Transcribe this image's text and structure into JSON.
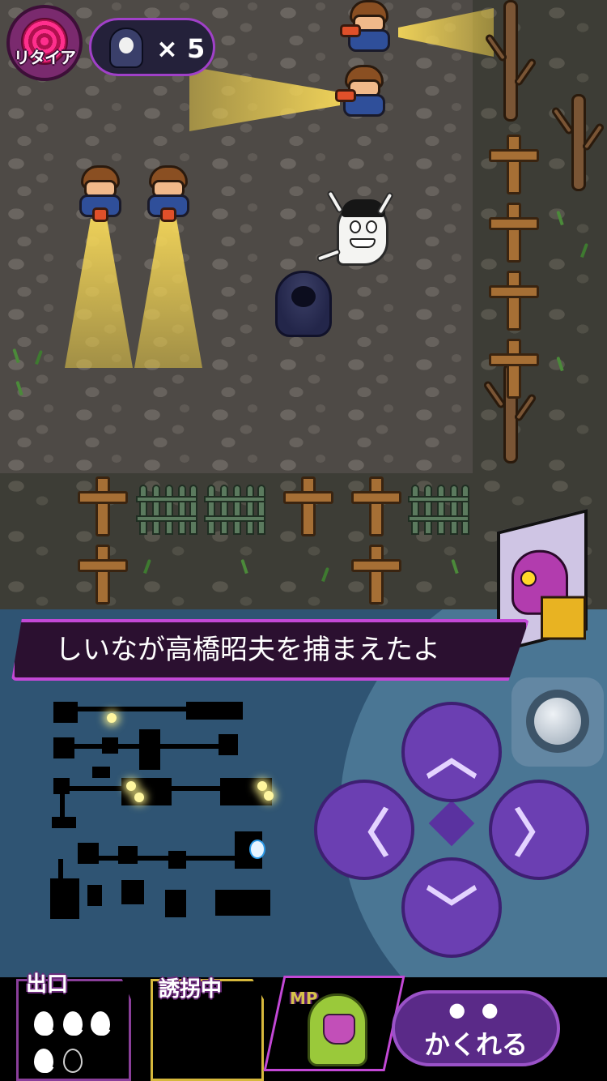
{
  "hud": {
    "retire_label": "リタイア",
    "ghost_count_text": "× 5"
  },
  "dialog": {
    "message": "しいなが高橋昭夫を捕まえたよ"
  },
  "bottom": {
    "exit_label": "出口",
    "exit_souls_filled": 4,
    "exit_souls_total": 5,
    "kidnap_label": "誘拐中",
    "mp_label": "MP",
    "hide_eyes": "● ●",
    "hide_label": "かくれる"
  },
  "colors": {
    "accent_purple": "#c348d6",
    "dpad_purple": "#6b3fb2",
    "panel_blue": "#2f5473",
    "beam_yellow": "#f5d75a"
  },
  "icons": {
    "retire": "pink-spiral-icon",
    "ghost_count": "reaper-ghost-icon",
    "up": "arrow-up-icon",
    "down": "arrow-down-icon",
    "left": "arrow-left-icon",
    "right": "arrow-right-icon"
  },
  "dpad": {
    "up": "︿",
    "down": "﹀",
    "left": "〈",
    "right": "〉"
  }
}
